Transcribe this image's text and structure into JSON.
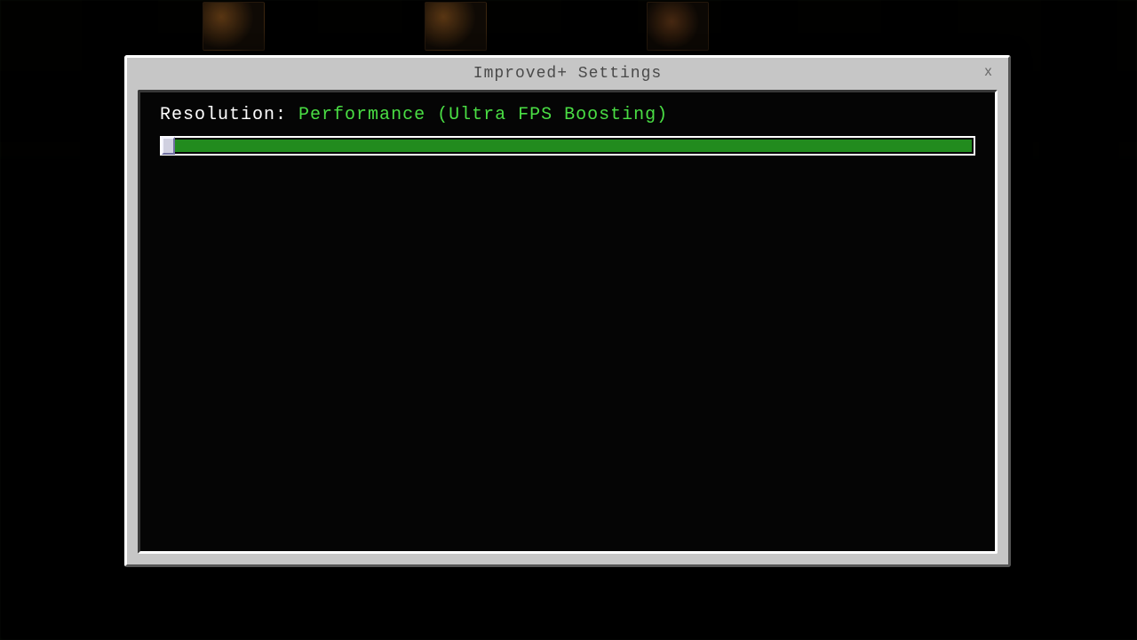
{
  "dialog": {
    "title": "Improved+ Settings",
    "close_glyph": "x"
  },
  "setting": {
    "label": "Resolution:",
    "value": "Performance (Ultra FPS Boosting)",
    "slider_percent": 0,
    "colors": {
      "label": "#ffffff",
      "value": "#4ade44",
      "fill": "#228b1e"
    }
  }
}
